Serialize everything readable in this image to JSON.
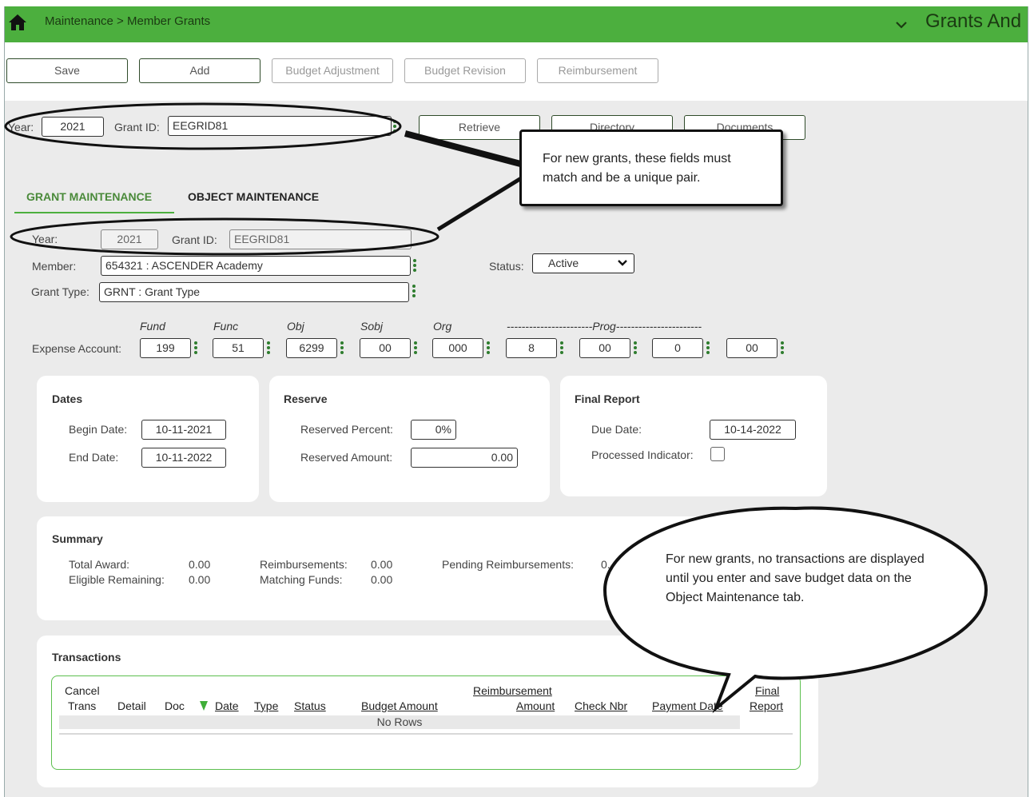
{
  "header": {
    "breadcrumb": "Maintenance > Member Grants",
    "app_title": "Grants And",
    "bar_color": "#4caf3e"
  },
  "toolbar": {
    "save": "Save",
    "add": "Add",
    "budget_adjustment": "Budget Adjustment",
    "budget_revision": "Budget Revision",
    "reimbursement": "Reimbursement"
  },
  "search": {
    "year_label": "Year:",
    "year_value": "2021",
    "grant_id_label": "Grant ID:",
    "grant_id_value": "EEGRID81",
    "retrieve": "Retrieve",
    "directory": "Directory",
    "documents": "Documents"
  },
  "tabs": [
    {
      "label": "GRANT MAINTENANCE",
      "active": true
    },
    {
      "label": "OBJECT MAINTENANCE",
      "active": false
    }
  ],
  "form": {
    "year_label": "Year:",
    "year_value": "2021",
    "grant_id_label": "Grant ID:",
    "grant_id_value": "EEGRID81",
    "member_label": "Member:",
    "member_value": "654321 : ASCENDER Academy",
    "status_label": "Status:",
    "status_value": "Active",
    "grant_type_label": "Grant Type:",
    "grant_type_value": "GRNT : Grant Type"
  },
  "expense_account": {
    "label": "Expense Account:",
    "headers": {
      "fund": "Fund",
      "func": "Func",
      "obj": "Obj",
      "sobj": "Sobj",
      "org": "Org",
      "prog": "-----------------------Prog-----------------------"
    },
    "values": {
      "fund": "199",
      "func": "51",
      "obj": "6299",
      "sobj": "00",
      "org": "000",
      "fy": "8",
      "prog1": "00",
      "prog2": "0",
      "prog3": "00"
    }
  },
  "dates": {
    "title": "Dates",
    "begin_label": "Begin Date:",
    "begin_value": "10-11-2021",
    "end_label": "End Date:",
    "end_value": "10-11-2022"
  },
  "reserve": {
    "title": "Reserve",
    "percent_label": "Reserved Percent:",
    "percent_value": "0%",
    "amount_label": "Reserved Amount:",
    "amount_value": "0.00"
  },
  "final_report": {
    "title": "Final Report",
    "due_label": "Due Date:",
    "due_value": "10-14-2022",
    "processed_label": "Processed Indicator:",
    "processed_checked": false
  },
  "summary": {
    "title": "Summary",
    "total_award_label": "Total Award:",
    "total_award_value": "0.00",
    "eligible_label": "Eligible Remaining:",
    "eligible_value": "0.00",
    "reimb_label": "Reimbursements:",
    "reimb_value": "0.00",
    "matching_label": "Matching Funds:",
    "matching_value": "0.00",
    "pending_label": "Pending Reimbursements:",
    "pending_value": "0."
  },
  "transactions": {
    "title": "Transactions",
    "columns": {
      "cancel": "Cancel",
      "trans": "Trans",
      "detail": "Detail",
      "doc": "Doc",
      "date": "Date",
      "type": "Type",
      "status": "Status",
      "budget_amount": "Budget Amount",
      "reimbursement": "Reimbursement",
      "amount": "Amount",
      "check_nbr": "Check Nbr",
      "payment_date": "Payment Date",
      "final": "Final",
      "report": "Report"
    },
    "empty_text": "No Rows"
  },
  "callouts": {
    "fields_note": "For new grants, these fields must match and be a unique pair.",
    "transactions_note": "For new grants, no transactions are displayed until you enter and save budget data on the Object Maintenance tab."
  }
}
